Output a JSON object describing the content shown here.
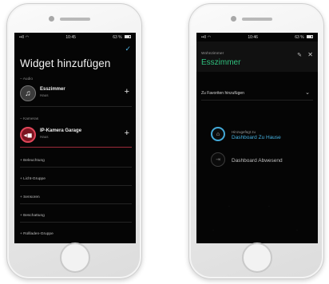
{
  "left_phone": {
    "status": {
      "carrier": "••ll",
      "time": "10:45",
      "battery": "63 %"
    },
    "title": "Widget hinzufügen",
    "sections": [
      {
        "label": "– Audio",
        "item": {
          "name": "Esszimmer",
          "sub": "Haus"
        }
      },
      {
        "label": "– Kameras",
        "item": {
          "name": "IP-Kamera Garage",
          "sub": "Haus"
        }
      }
    ],
    "categories": [
      "+ Beleuchtung",
      "+ Licht-Gruppe",
      "+ Sensoren",
      "+ Beschattung",
      "+ Rollladen-Gruppe"
    ],
    "accent": "#4fb6e3",
    "camera_color": "#e0465a"
  },
  "right_phone": {
    "status": {
      "carrier": "••ll",
      "time": "10:46",
      "battery": "63 %"
    },
    "room_label": "Wohnzimmer",
    "room_name": "Esszimmer",
    "favorites_label": "Zu Favoriten hinzufügen",
    "dashboards": [
      {
        "added_label": "Hinzugefügt zu",
        "name": "Dashboard Zu Hause",
        "state": "active"
      },
      {
        "name": "Dashboard Abwesend",
        "state": "inactive"
      }
    ],
    "room_color": "#30c07e",
    "dashboard_active_color": "#45b2e2"
  }
}
